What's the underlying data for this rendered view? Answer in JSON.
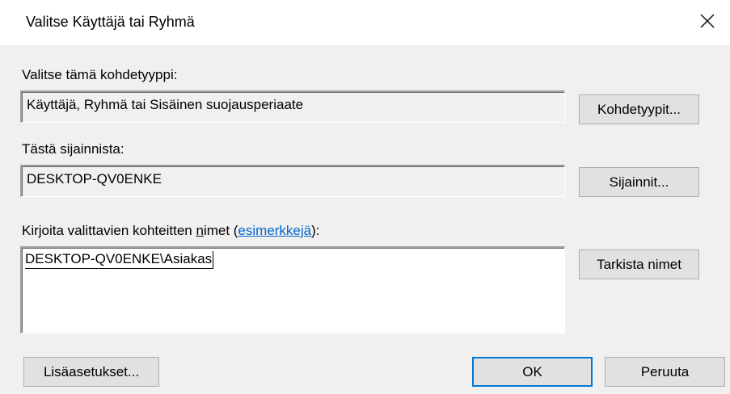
{
  "window": {
    "title": "Valitse Käyttäjä tai Ryhmä",
    "close_glyph": "✕"
  },
  "object_type": {
    "label": "Valitse tämä kohdetyyppi:",
    "value": "Käyttäjä, Ryhmä tai Sisäinen suojausperiaate",
    "button": "Kohdetyypit..."
  },
  "location": {
    "label": "Tästä sijainnista:",
    "value": "DESKTOP-QV0ENKE",
    "button": "Sijainnit..."
  },
  "names": {
    "label_prefix": "Kirjoita valittavien kohteitten ",
    "label_underlined": "n",
    "label_mid": "imet (",
    "label_link": "esimerkkejä",
    "label_suffix": "):",
    "value": "DESKTOP-QV0ENKE\\Asiakas",
    "check_button": "Tarkista nimet"
  },
  "footer": {
    "advanced_button": "Lisäasetukset...",
    "ok_button": "OK",
    "cancel_button": "Peruuta"
  },
  "colors": {
    "accent": "#0078d7",
    "link": "#0066cc",
    "dialog_bg": "#f0f0f0",
    "button_bg": "#e1e1e1"
  }
}
